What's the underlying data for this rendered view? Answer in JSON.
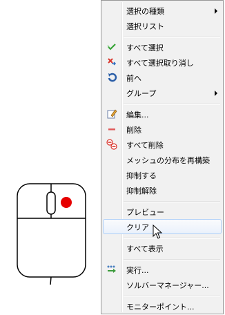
{
  "menu": {
    "items": [
      {
        "label": "選択の種類",
        "icon": "none",
        "submenu": true
      },
      {
        "label": "選択リスト",
        "icon": "none",
        "submenu": false
      },
      {
        "label": "すべて選択",
        "icon": "green-check-icon",
        "submenu": false
      },
      {
        "label": "すべて選択取り消し",
        "icon": "red-cross-icon",
        "submenu": false
      },
      {
        "label": "前へ",
        "icon": "undo-arrow-icon",
        "submenu": false
      },
      {
        "label": "グループ",
        "icon": "none",
        "submenu": true
      },
      {
        "label": "編集...",
        "icon": "edit-note-icon",
        "submenu": false
      },
      {
        "label": "削除",
        "icon": "minus-icon",
        "submenu": false
      },
      {
        "label": "すべて削除",
        "icon": "delete-all-icon",
        "submenu": false
      },
      {
        "label": "メッシュの分布を再構築",
        "icon": "none",
        "submenu": false
      },
      {
        "label": "抑制する",
        "icon": "none",
        "submenu": false
      },
      {
        "label": "抑制解除",
        "icon": "none",
        "submenu": false
      },
      {
        "label": "プレビュー",
        "icon": "none",
        "submenu": false
      },
      {
        "label": "クリア",
        "icon": "none",
        "submenu": false,
        "highlighted": true
      },
      {
        "label": "すべて表示",
        "icon": "none",
        "submenu": false
      },
      {
        "label": "実行...",
        "icon": "run-icon",
        "submenu": false
      },
      {
        "label": "ソルバーマネージャー...",
        "icon": "none",
        "submenu": false
      },
      {
        "label": "モニターポイント...",
        "icon": "none",
        "submenu": false
      }
    ]
  },
  "colors": {
    "menu_bg": "#f1f1f1",
    "highlight_border": "#aecff7",
    "mouse_button_dot": "#e60000"
  }
}
